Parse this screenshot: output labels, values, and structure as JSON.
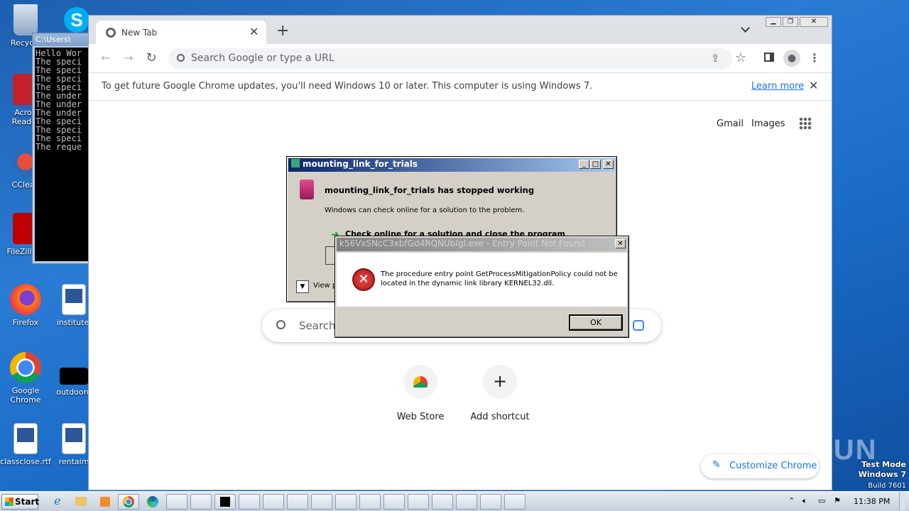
{
  "desktop": {
    "icons": [
      {
        "label": "Recycle",
        "icon": "recycle-bin-icon"
      },
      {
        "label": "Acrob Reader",
        "icon": "acrobat-reader-icon"
      },
      {
        "label": "CClean",
        "icon": "ccleaner-icon"
      },
      {
        "label": "FileZilla C",
        "icon": "filezilla-icon"
      },
      {
        "label": "Firefox",
        "icon": "firefox-icon"
      },
      {
        "label": "institutel",
        "icon": "word-document-icon"
      },
      {
        "label": "Google Chrome",
        "icon": "chrome-icon"
      },
      {
        "label": "outdoord",
        "icon": "black-file-icon"
      },
      {
        "label": "classclose.rtf",
        "icon": "word-document-icon"
      },
      {
        "label": "rentaim",
        "icon": "word-document-icon"
      }
    ],
    "watermark": {
      "brand": "ANY RUN",
      "test_mode": "Test Mode",
      "os": "Windows 7",
      "build": "Build 7601"
    }
  },
  "cmd": {
    "title": "C:\\Users\\",
    "lines": [
      "Hello Wor",
      "The speci",
      "The speci",
      "The speci",
      "The speci",
      "The under",
      "The under",
      "The under",
      "The speci",
      "The speci",
      "The speci",
      "The reque"
    ]
  },
  "chrome": {
    "tab_title": "New Tab",
    "omnibox_placeholder": "Search Google or type a URL",
    "infobar_text": "To get future Google Chrome updates, you'll need Windows 10 or later. This computer is using Windows 7.",
    "infobar_link": "Learn more",
    "top_links": {
      "gmail": "Gmail",
      "images": "Images"
    },
    "search_placeholder": "Search",
    "shortcuts": [
      {
        "label": "Web Store"
      },
      {
        "label": "Add shortcut"
      }
    ],
    "customize_label": "Customize Chrome"
  },
  "crash_dialog": {
    "title": "mounting_link_for_trials",
    "heading": "mounting_link_for_trials has stopped working",
    "message": "Windows can check online for a solution to the problem.",
    "option1": "Check online for a solution and close the program",
    "view_label": "View p"
  },
  "error_dialog": {
    "title": "k56VxSNcC3xbfGd4RQNUbIgl.exe - Entry Point Not Found",
    "message_line1": "The procedure entry point GetProcessMitigationPolicy could not be",
    "message_line2": "located in the dynamic link library KERNEL32.dll.",
    "ok_label": "OK"
  },
  "taskbar": {
    "start_label": "Start",
    "clock": "11:38 PM"
  },
  "colors": {
    "accent": "#1a73e8",
    "error_red": "#c4262e",
    "title_blue": "#0a246a"
  }
}
